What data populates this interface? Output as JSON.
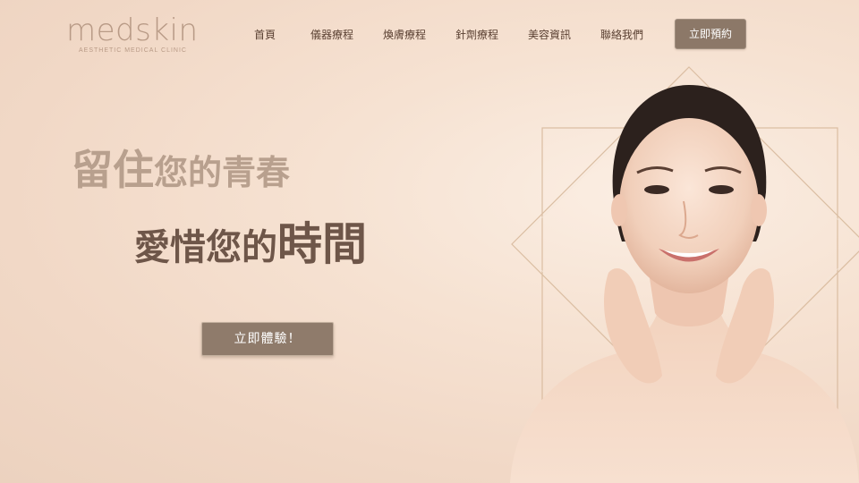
{
  "brand": {
    "logo_text": "medskin",
    "logo_subtitle": "AESTHETIC MEDICAL CLINIC",
    "color": "#b89a86"
  },
  "nav": {
    "items": [
      "首頁",
      "儀器療程",
      "煥膚療程",
      "針劑療程",
      "美容資訊",
      "聯絡我們"
    ],
    "book_label": "立即預約"
  },
  "hero": {
    "line1_big": "留住",
    "line1_small": "您的青春",
    "line2_small": "愛惜您的",
    "line2_big": "時間",
    "cta_label": "立即體驗！"
  },
  "colors": {
    "accent": "#8c7868",
    "headline_light": "#b8a08e",
    "headline_dark": "#6e5649",
    "frame_gold": "#d7b99c"
  },
  "icons": {
    "model_photo": "smiling-woman-photo"
  }
}
